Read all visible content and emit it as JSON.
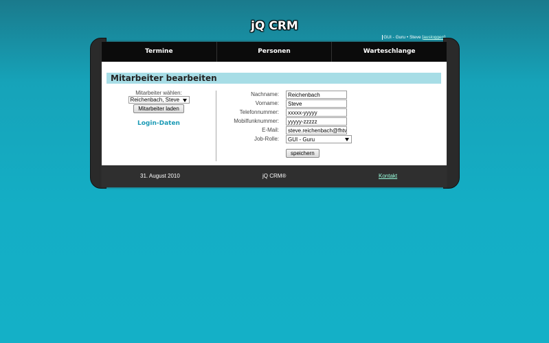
{
  "app": {
    "title": "jQ CRM"
  },
  "userbar": {
    "role": "GUI - Guru",
    "user": "Steve",
    "logout_label": "ausloggen"
  },
  "nav": {
    "items": [
      "Termine",
      "Personen",
      "Warteschlange"
    ]
  },
  "section": {
    "title": "Mitarbeiter bearbeiten"
  },
  "left": {
    "select_label": "Mitarbeiter wählen:",
    "selected_employee": "Reichenbach, Steve",
    "load_button": "Mitarbeiter laden",
    "login_data_link": "Login-Daten"
  },
  "form": {
    "fields": [
      {
        "label": "Nachname:",
        "value": "Reichenbach"
      },
      {
        "label": "Vorname:",
        "value": "Steve"
      },
      {
        "label": "Telefonnummer:",
        "value": "xxxxx-yyyyy"
      },
      {
        "label": "Mobilfunknummer:",
        "value": "yyyyy-zzzzz"
      },
      {
        "label": "E-Mail:",
        "value": "steve.reichenbach@fhtw"
      },
      {
        "label": "Job-Rolle:",
        "value": "GUI - Guru"
      }
    ],
    "save_button": "speichern"
  },
  "footer": {
    "date": "31. August 2010",
    "brand": "jQ CRM®",
    "contact_link": "Kontakt"
  }
}
